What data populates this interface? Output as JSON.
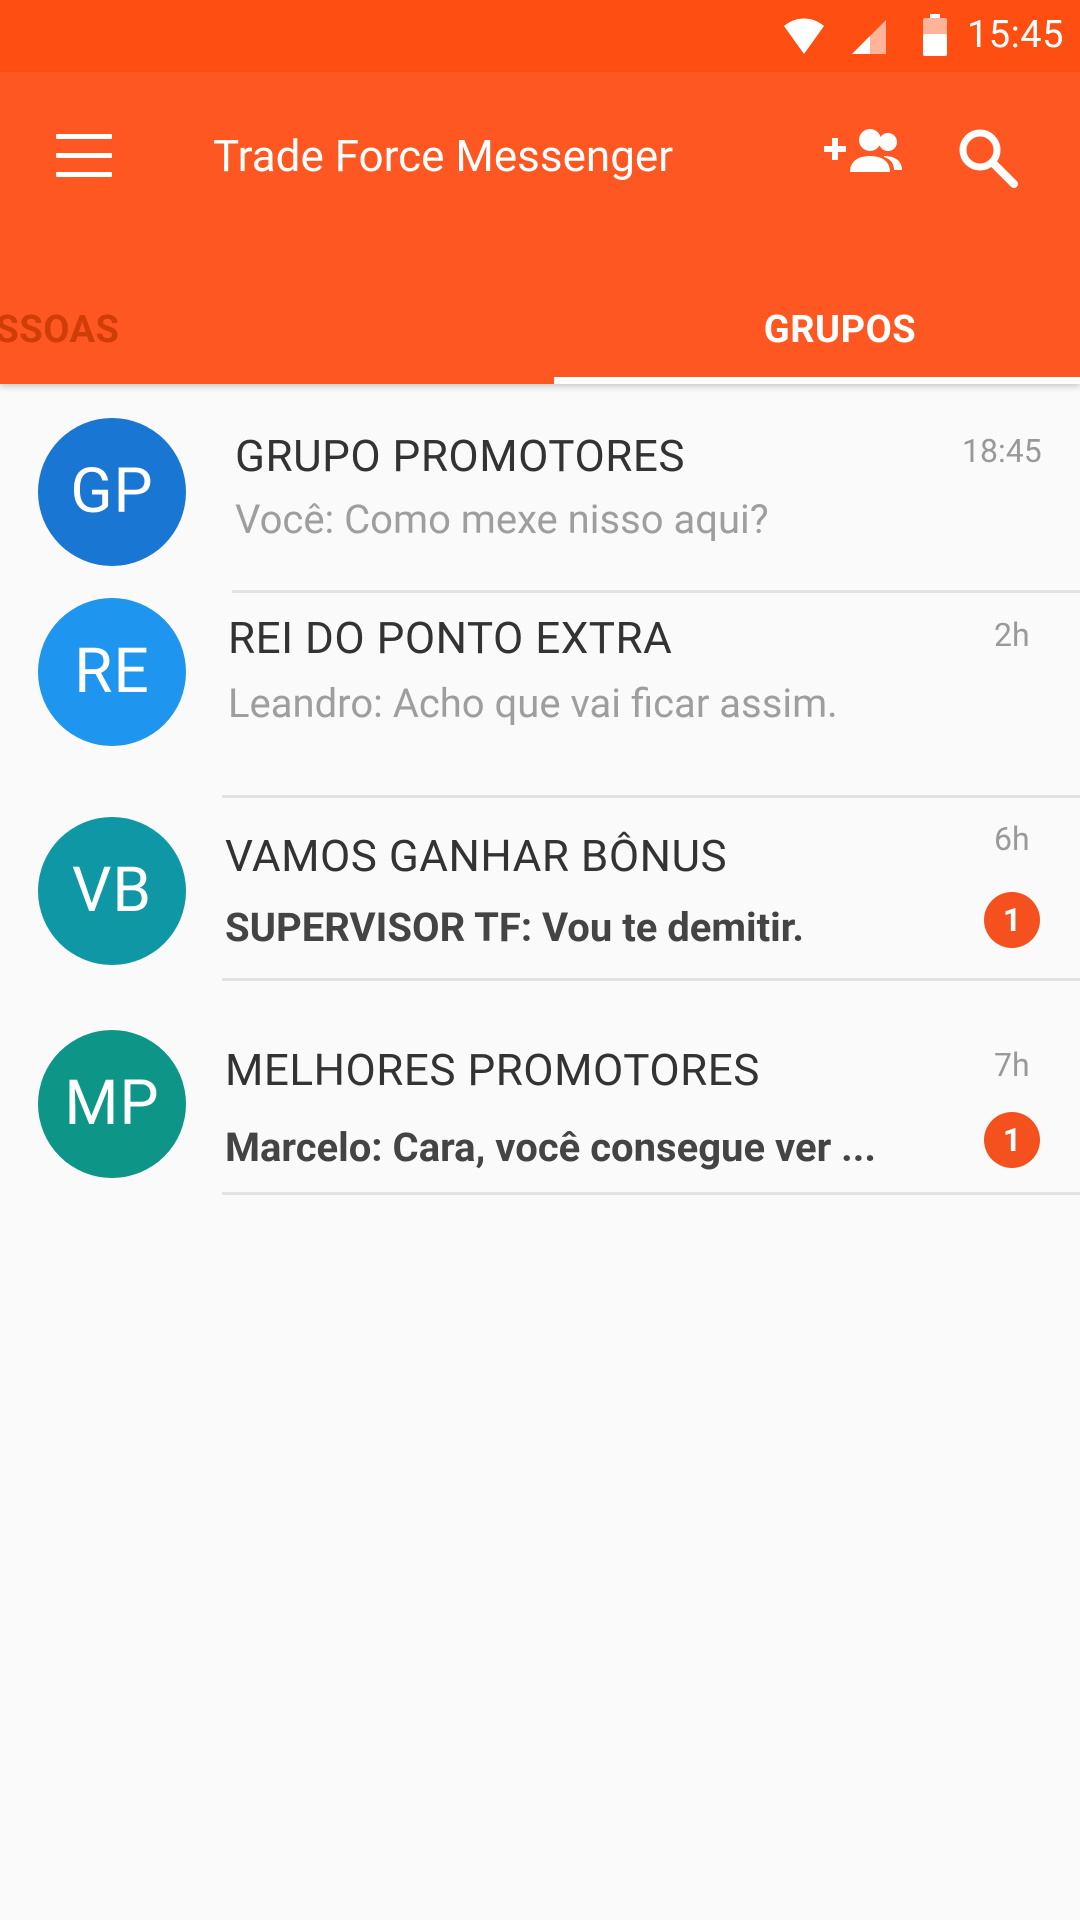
{
  "status_bar": {
    "time": "15:45"
  },
  "app_bar": {
    "title": "Trade Force Messenger",
    "tabs": [
      {
        "label": "PESSOAS",
        "selected": false
      },
      {
        "label": "GRUPOS",
        "selected": true
      }
    ]
  },
  "colors": {
    "status_bar": "#ff4e12",
    "app_bar": "#ff5722",
    "badge": "#f4511e"
  },
  "groups": [
    {
      "initials": "GP",
      "name": "GRUPO PROMOTORES",
      "preview": "Você: Como mexe nisso aqui?",
      "time": "18:45",
      "unread": "",
      "avatar_color": "#1976d2"
    },
    {
      "initials": "RE",
      "name": "REI DO PONTO EXTRA",
      "preview": "Leandro: Acho que vai ficar assim.",
      "time": "2h",
      "unread": "",
      "avatar_color": "#1e96f0"
    },
    {
      "initials": "VB",
      "name": "VAMOS GANHAR BÔNUS",
      "preview": "SUPERVISOR TF: Vou te demitir.",
      "time": "6h",
      "unread": "1",
      "avatar_color": "#0f97a6"
    },
    {
      "initials": "MP",
      "name": "MELHORES PROMOTORES",
      "preview": "Marcelo: Cara, você consegue ver ...",
      "time": "7h",
      "unread": "1",
      "avatar_color": "#0d9688"
    }
  ]
}
